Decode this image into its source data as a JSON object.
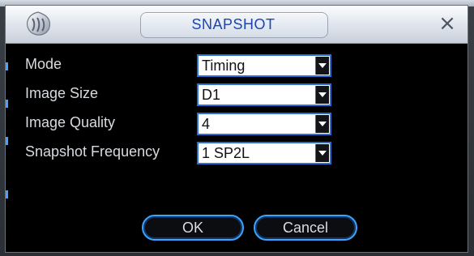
{
  "dialog": {
    "title": "SNAPSHOT",
    "close_symbol": "×"
  },
  "fields": [
    {
      "label": "Mode",
      "value": "Timing"
    },
    {
      "label": "Image Size",
      "value": "D1"
    },
    {
      "label": "Image Quality",
      "value": "4"
    },
    {
      "label": "Snapshot Frequency",
      "value": "1 SP2L"
    }
  ],
  "buttons": {
    "ok_label": "OK",
    "cancel_label": "Cancel"
  },
  "icons": {
    "logo": "brand-logo-icon",
    "close": "close-icon",
    "dropdown": "chevron-down-icon"
  },
  "colors": {
    "title_text": "#1a44b8",
    "focus_border": "#2b6fd6",
    "button_border": "#3aa4ff",
    "label_text": "#d7dbe0"
  }
}
